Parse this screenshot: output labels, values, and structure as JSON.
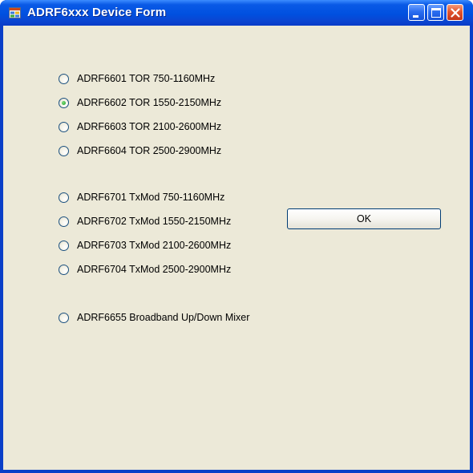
{
  "window": {
    "title": "ADRF6xxx Device Form",
    "icons": {
      "app": "app-form-icon",
      "minimize": "minimize-icon",
      "maximize": "maximize-icon",
      "close": "close-icon"
    },
    "colors": {
      "titlebar": "#0050e0",
      "client_bg": "#ece9d8",
      "close_button": "#e2552f"
    }
  },
  "devices": [
    {
      "label": "ADRF6601 TOR 750-1160MHz",
      "selected": false
    },
    {
      "label": "ADRF6602 TOR 1550-2150MHz",
      "selected": true
    },
    {
      "label": "ADRF6603 TOR 2100-2600MHz",
      "selected": false
    },
    {
      "label": "ADRF6604 TOR 2500-2900MHz",
      "selected": false
    },
    {
      "label": "ADRF6701 TxMod 750-1160MHz",
      "selected": false
    },
    {
      "label": "ADRF6702 TxMod 1550-2150MHz",
      "selected": false
    },
    {
      "label": "ADRF6703 TxMod 2100-2600MHz",
      "selected": false
    },
    {
      "label": "ADRF6704 TxMod 2500-2900MHz",
      "selected": false
    },
    {
      "label": "ADRF6655 Broadband Up/Down Mixer",
      "selected": false
    }
  ],
  "ok_button": {
    "label": "OK"
  }
}
